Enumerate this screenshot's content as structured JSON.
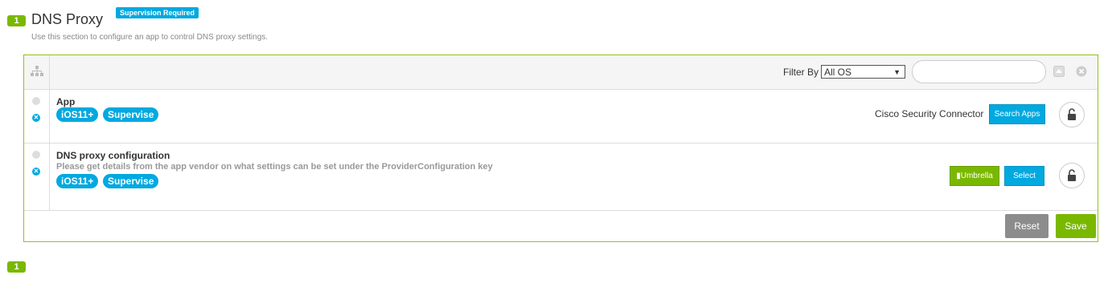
{
  "section": {
    "number": "1",
    "title": "DNS Proxy",
    "supervision_badge": "Supervision Required",
    "description": "Use this section to configure an app to control DNS proxy settings."
  },
  "toolbar": {
    "filter_label": "Filter By",
    "filter_value": "All OS",
    "search_value": ""
  },
  "rows": [
    {
      "title": "App",
      "pills": [
        "iOS11+",
        "Supervise"
      ],
      "app_name": "Cisco Security Connector",
      "button": "Search Apps"
    },
    {
      "title": "DNS proxy configuration",
      "subtitle": "Please get details from the app vendor on what settings can be set under the ProviderConfiguration key",
      "pills": [
        "iOS11+",
        "Supervise"
      ],
      "file_button": "Umbrella",
      "select_button": "Select"
    }
  ],
  "footer": {
    "reset": "Reset",
    "save": "Save"
  },
  "next_section_number": "1",
  "colors": {
    "accent_green": "#7ab800",
    "accent_blue": "#00a9e0",
    "reset_gray": "#8c8c8c"
  }
}
